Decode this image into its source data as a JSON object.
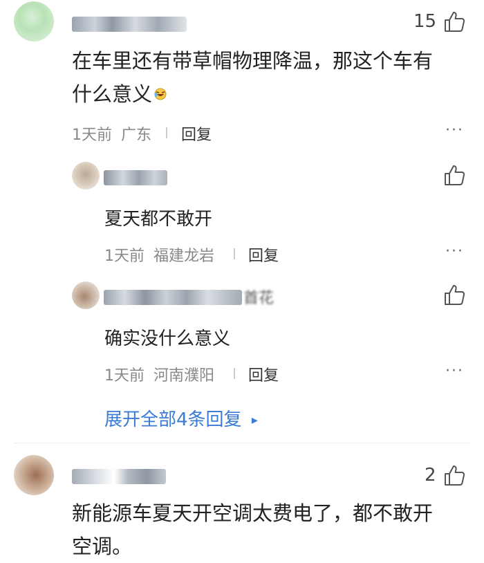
{
  "comments": [
    {
      "likes": "15",
      "text_line1": "在车里还有带草帽物理降温，那这个车有",
      "text_line2": "什么意义",
      "emoji": "laughing-crying-emoji",
      "time": "1天前",
      "location": "广东",
      "reply_label": "回复",
      "replies": [
        {
          "text": "夏天都不敢开",
          "time": "1天前",
          "location": "福建龙岩",
          "reply_label": "回复"
        },
        {
          "name_tail": "首花",
          "text": "确实没什么意义",
          "time": "1天前",
          "location": "河南濮阳",
          "reply_label": "回复"
        }
      ],
      "expand_label": "展开全部4条回复",
      "expand_arrow": "▸"
    },
    {
      "likes": "2",
      "text_line1": "新能源车夏天开空调太费电了，都不敢开",
      "text_line2": "空调。"
    }
  ],
  "more_icon": "···",
  "colors": {
    "link": "#3a7bd5",
    "meta": "#888888",
    "text": "#222222"
  }
}
